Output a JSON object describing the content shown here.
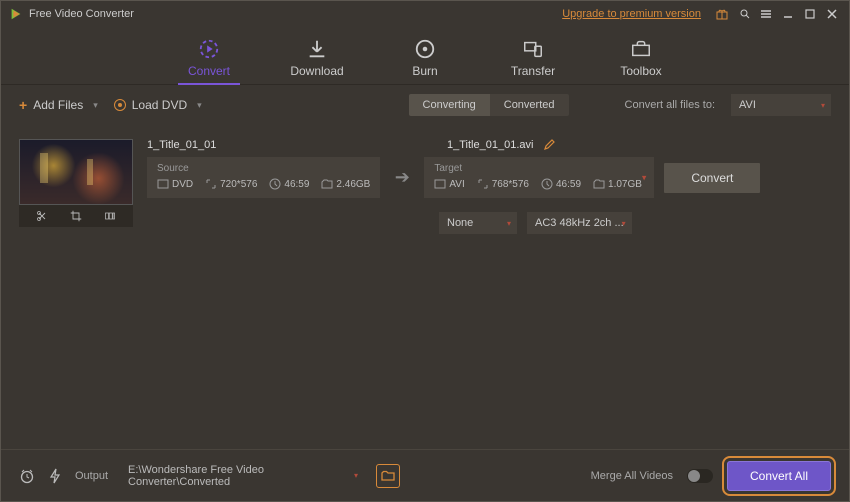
{
  "titlebar": {
    "app_name": "Free Video Converter",
    "upgrade_link": "Upgrade to premium version"
  },
  "nav": {
    "items": [
      {
        "label": "Convert",
        "icon": "convert-icon",
        "active": true
      },
      {
        "label": "Download",
        "icon": "download-icon",
        "active": false
      },
      {
        "label": "Burn",
        "icon": "burn-icon",
        "active": false
      },
      {
        "label": "Transfer",
        "icon": "transfer-icon",
        "active": false
      },
      {
        "label": "Toolbox",
        "icon": "toolbox-icon",
        "active": false
      }
    ]
  },
  "subbar": {
    "add_files": "Add Files",
    "load_dvd": "Load DVD",
    "tabs": {
      "converting": "Converting",
      "converted": "Converted",
      "active": "converting"
    },
    "convert_all_label": "Convert all files to:",
    "format_selected": "AVI"
  },
  "item": {
    "source_title": "1_Title_01_01",
    "target_title": "1_Title_01_01.avi",
    "source": {
      "label": "Source",
      "format": "DVD",
      "resolution": "720*576",
      "duration": "46:59",
      "size": "2.46GB"
    },
    "target": {
      "label": "Target",
      "format": "AVI",
      "resolution": "768*576",
      "duration": "46:59",
      "size": "1.07GB"
    },
    "convert_button": "Convert",
    "subtitle_select": "None",
    "audio_select": "AC3 48kHz 2ch ..."
  },
  "footer": {
    "output_label": "Output",
    "output_path": "E:\\Wondershare Free Video Converter\\Converted",
    "merge_label": "Merge All Videos",
    "convert_all_button": "Convert All"
  }
}
